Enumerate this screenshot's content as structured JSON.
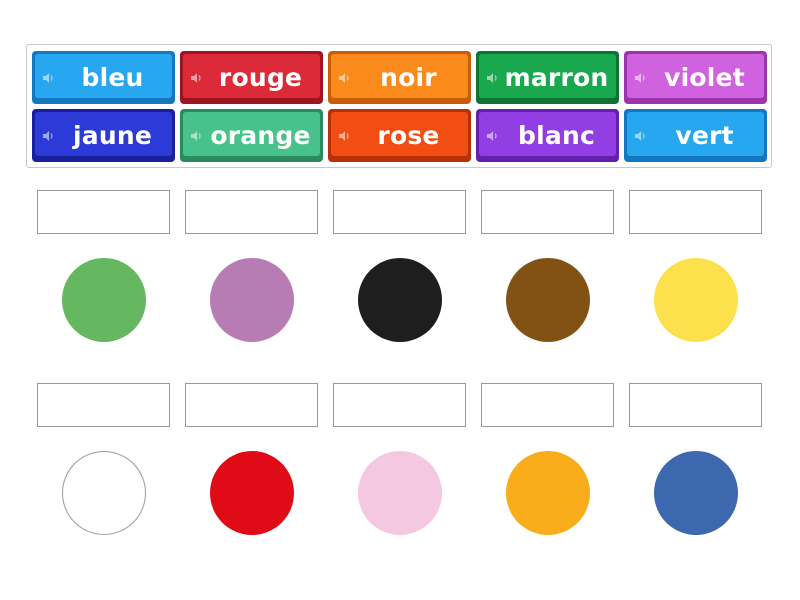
{
  "tiles": [
    {
      "label": "bleu",
      "bg": "#1e9be6",
      "inner": "#26a7f0",
      "shadow": "#1478c0",
      "icon": "speaker-icon"
    },
    {
      "label": "rouge",
      "bg": "#cc1f2d",
      "inner": "#dc2a38",
      "shadow": "#a0131f",
      "icon": "speaker-icon"
    },
    {
      "label": "noir",
      "bg": "#f07a10",
      "inner": "#fb8a1c",
      "shadow": "#c85d06",
      "icon": "speaker-icon"
    },
    {
      "label": "marron",
      "bg": "#159a45",
      "inner": "#1aa84e",
      "shadow": "#0e7432",
      "icon": "speaker-icon"
    },
    {
      "label": "violet",
      "bg": "#c452d4",
      "inner": "#d061df",
      "shadow": "#9b35ac",
      "icon": "speaker-icon"
    },
    {
      "label": "jaune",
      "bg": "#2430c8",
      "inner": "#2c3bd8",
      "shadow": "#18209c",
      "icon": "speaker-icon"
    },
    {
      "label": "orange",
      "bg": "#3fb680",
      "inner": "#47c28a",
      "shadow": "#2a8c5e",
      "icon": "speaker-icon"
    },
    {
      "label": "rose",
      "bg": "#e8420f",
      "inner": "#f24e14",
      "shadow": "#b83006",
      "icon": "speaker-icon"
    },
    {
      "label": "blanc",
      "bg": "#8433d8",
      "inner": "#913fe4",
      "shadow": "#6420ac",
      "icon": "speaker-icon"
    },
    {
      "label": "vert",
      "bg": "#1e9be6",
      "inner": "#26a7f0",
      "shadow": "#1478c0",
      "icon": "speaker-icon"
    }
  ],
  "drop_rows": [
    {
      "swatches": [
        "#65b760",
        "#b77cb4",
        "#1e1e1e",
        "#825214",
        "#fde14c"
      ]
    },
    {
      "swatches": [
        "#ffffff",
        "#df0c18",
        "#f4c8e0",
        "#f9ad1a",
        "#3d68b0"
      ]
    }
  ]
}
